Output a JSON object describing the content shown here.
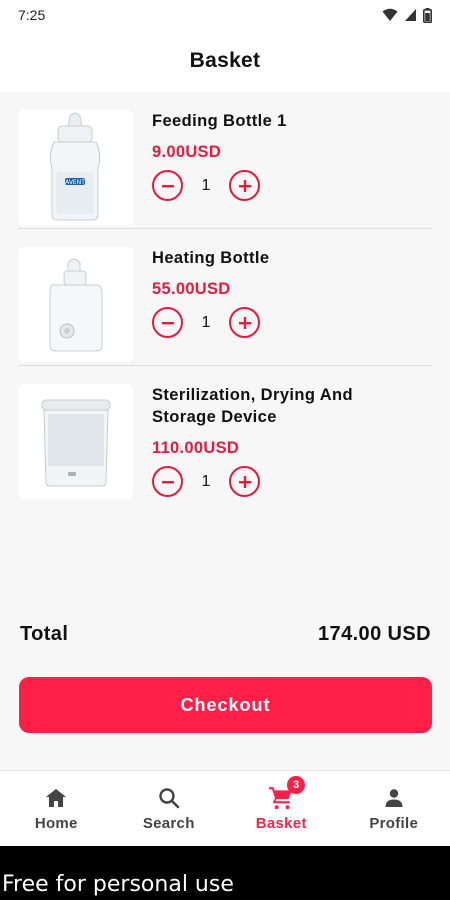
{
  "status_bar": {
    "time": "7:25",
    "icons": [
      "wifi-icon",
      "signal-icon",
      "battery-icon"
    ]
  },
  "header": {
    "title": "Basket"
  },
  "items": [
    {
      "name": "Feeding Bottle 1",
      "price": "9.00USD",
      "quantity": "1",
      "image": "feeding-bottle-image"
    },
    {
      "name": "Heating Bottle",
      "price": "55.00USD",
      "quantity": "1",
      "image": "bottle-warmer-image"
    },
    {
      "name": "Sterilization, Drying And Storage Device",
      "price": "110.00USD",
      "quantity": "1",
      "image": "sterilizer-image"
    }
  ],
  "summary": {
    "total_label": "Total",
    "total_value": "174.00 USD"
  },
  "checkout": {
    "label": "Checkout"
  },
  "nav": {
    "items": [
      {
        "label": "Home",
        "icon": "home-icon"
      },
      {
        "label": "Search",
        "icon": "search-icon"
      },
      {
        "label": "Basket",
        "icon": "cart-icon",
        "badge": "3",
        "active": true
      },
      {
        "label": "Profile",
        "icon": "person-icon"
      }
    ]
  },
  "watermark": {
    "text": "Free for personal use"
  },
  "colors": {
    "accent": "#ff1f47",
    "price": "#e8193c",
    "background": "#f7f7f7"
  }
}
